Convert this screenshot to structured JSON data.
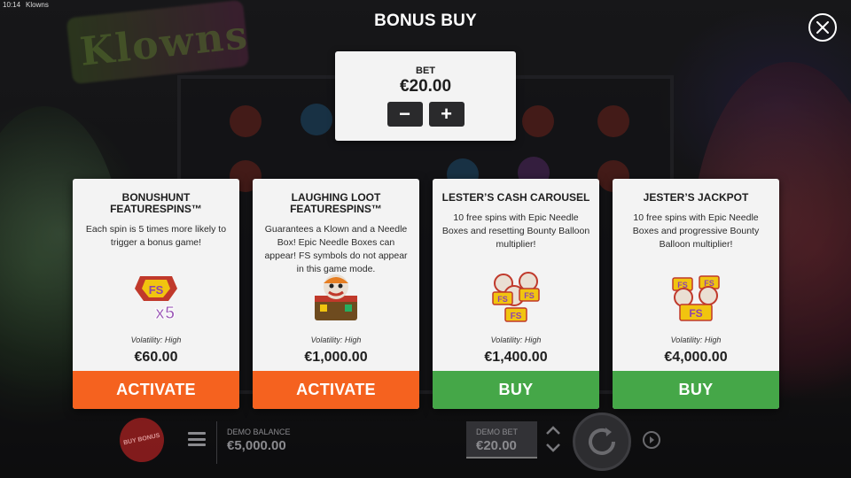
{
  "status_bar": {
    "time": "10:14",
    "app_name": "Klowns"
  },
  "header": {
    "title": "BONUS BUY",
    "close_icon": "close-icon"
  },
  "bet": {
    "label": "BET",
    "value": "€20.00",
    "decrease_label": "−",
    "increase_label": "+"
  },
  "background": {
    "logo_text": "Klowns"
  },
  "cards": [
    {
      "title": "BONUSHUNT FEATURESPINS™",
      "description": "Each spin is 5 times more likely to trigger a bonus game!",
      "art_icon": "fs-x5-symbol-icon",
      "volatility": "Volatility: High",
      "price": "€60.00",
      "cta": "ACTIVATE",
      "cta_color": "#f5621f"
    },
    {
      "title": "LAUGHING LOOT FEATURESPINS™",
      "description": "Guarantees a Klown and a Needle Box! Epic Needle Boxes can appear! FS symbols do not appear in this game mode.",
      "art_icon": "klown-needle-box-icon",
      "volatility": "Volatility: High",
      "price": "€1,000.00",
      "cta": "ACTIVATE",
      "cta_color": "#f5621f"
    },
    {
      "title": "LESTER’S CASH CAROUSEL",
      "description": "10 free spins with Epic Needle Boxes and resetting Bounty Balloon multiplier!",
      "art_icon": "fs-symbols-cluster-icon",
      "volatility": "Volatility: High",
      "price": "€1,400.00",
      "cta": "BUY",
      "cta_color": "#45a748"
    },
    {
      "title": "JESTER’S JACKPOT",
      "description": "10 free spins with Epic Needle Boxes and progressive Bounty Balloon multiplier!",
      "art_icon": "fs-symbols-cluster-icon",
      "volatility": "Volatility: High",
      "price": "€4,000.00",
      "cta": "BUY",
      "cta_color": "#45a748"
    }
  ],
  "bottom_bar": {
    "buy_bonus_label": "BUY BONUS",
    "demo_balance_label": "DEMO BALANCE",
    "demo_balance_value": "€5,000.00",
    "demo_bet_label": "DEMO BET",
    "demo_bet_value": "€20.00"
  }
}
